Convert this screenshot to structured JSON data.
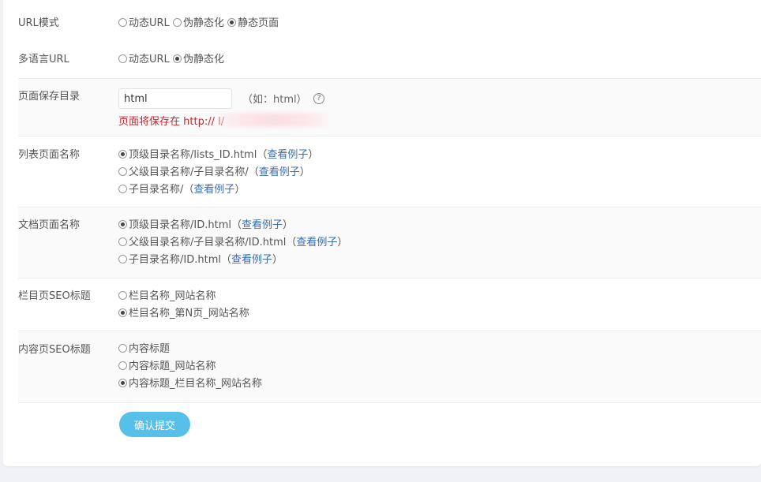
{
  "url_mode": {
    "label": "URL模式",
    "options": [
      "动态URL",
      "伪静态化",
      "静态页面"
    ],
    "selected": 2
  },
  "multilang_url": {
    "label": "多语言URL",
    "options": [
      "动态URL",
      "伪静态化"
    ],
    "selected": 1
  },
  "save_dir": {
    "label": "页面保存目录",
    "value": "html",
    "hint": "（如：html）",
    "help_icon": "question-circle-icon",
    "warning": "页面将保存在 http://                               l/"
  },
  "list_page_name": {
    "label": "列表页面名称",
    "options": [
      "顶级目录名称/lists_ID.html",
      "父级目录名称/子目录名称/",
      "子目录名称/"
    ],
    "example_link": "查看例子",
    "selected": 0
  },
  "doc_page_name": {
    "label": "文档页面名称",
    "options": [
      "顶级目录名称/ID.html",
      "父级目录名称/子目录名称/ID.html",
      "子目录名称/ID.html"
    ],
    "example_link": "查看例子",
    "selected": 0
  },
  "column_seo_title": {
    "label": "栏目页SEO标题",
    "options": [
      "栏目名称_网站名称",
      "栏目名称_第N页_网站名称"
    ],
    "selected": 1
  },
  "content_seo_title": {
    "label": "内容页SEO标题",
    "options": [
      "内容标题",
      "内容标题_网站名称",
      "内容标题_栏目名称_网站名称"
    ],
    "selected": 2
  },
  "submit_label": "确认提交",
  "colors": {
    "accent": "#56c0e8",
    "link": "#3a6db0",
    "warning": "#d0202a",
    "alt_row": "#fafafa"
  }
}
